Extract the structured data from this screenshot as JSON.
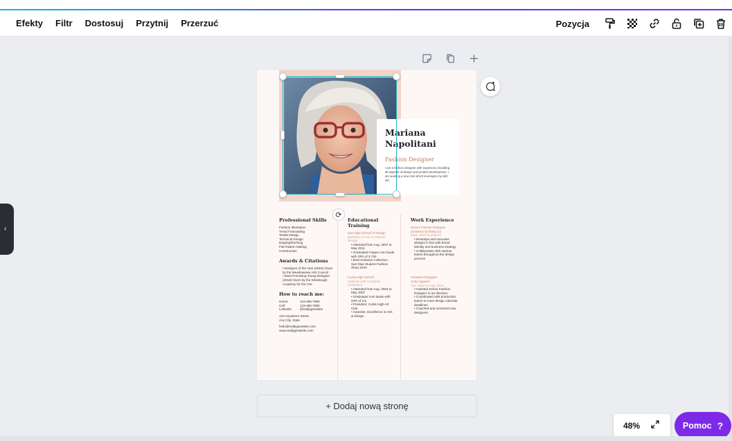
{
  "toolbar": {
    "items": [
      "Efekty",
      "Filtr",
      "Dostosuj",
      "Przytnij",
      "Przerzuć"
    ],
    "position_label": "Pozycja",
    "icons": [
      "paint-roller-icon",
      "transparency-icon",
      "link-icon",
      "lock-icon",
      "duplicate-icon",
      "trash-icon"
    ]
  },
  "resume": {
    "name_line1": "Mariana",
    "name_line2": "Napolitani",
    "role": "Fashion Designer",
    "bio": "I am a fashion designer with experience handling all aspects of design and product development. I am seeking a new role which leverages my skill set.",
    "skills_title": "Professional Skills",
    "skills": [
      "Fashion Illustration",
      "Trend Forecasting",
      "Textile Design",
      "Technical Design",
      "Draping/Ruching",
      "Flat Pattern Making",
      "Construction"
    ],
    "awards_title": "Awards & Citations",
    "awards": [
      "Designer of the Year (2019) Given by the Meadowview Arts Council",
      "Most Promising Young Designer (2018) Given by the Wiraslough Academy for the Arts"
    ],
    "contact_title": "How to reach me:",
    "contact": [
      {
        "label": "Home:",
        "value": "123-456-7890"
      },
      {
        "label": "Cell:",
        "value": "123-456-7890"
      },
      {
        "label": "LinkedIn:",
        "value": "@reallygreatsite"
      }
    ],
    "address_line1": "123 Anywhere Street,",
    "address_line2": "Any City, State",
    "email": "hello@reallygreatsite.com",
    "website": "www.reallygreatsite.com",
    "education_title": "Educational Training",
    "edu1_school": "San Dias School of Design",
    "edu1_degree": "Bachelor of Arts in Fashion Design",
    "edu1_items": [
      "Attended from Aug. 2007 to May 2011",
      "Graduated magna cum laude with GPA of 3.750",
      "Best Knitwear Collection, San Dias Student Fashion Show 2010"
    ],
    "edu2_school": "Curtis High School",
    "edu2_degree": "Diploma with Academic Distinction",
    "edu2_items": [
      "Attended from Aug. 2003 to May 2007",
      "Graduated cum laude with GPA of 3.5",
      "President, Curtis High Art Club",
      "Awardee, Excellence in Arts & Design"
    ],
    "work_title": "Work Experience",
    "job1_title": "Senior Fashion Designer",
    "job1_company": "23 BAKS Clothing Co.",
    "job1_dates": "Sept. 2019 to present",
    "job1_items": [
      "Develops and executes designs in line with brand identity and business strategy",
      "Collaborates with various teams throughout the design process"
    ],
    "job2_title": "Assistant Designer",
    "job2_company": "Arolo Apparel",
    "job2_dates": "Jan. 2016 to Aug. 2019",
    "job2_items": [
      "Assisted Senior Fashion Designer in art direction",
      "Coordinated with production teams to meet design calendar deadlines",
      "Coached and mentored new designers"
    ]
  },
  "add_page_label": "+ Dodaj nową stronę",
  "zoom": "48%",
  "help_label": "Pomoc",
  "help_icon": "?",
  "colors": {
    "accent": "#7d2ae8",
    "selection": "#19b5c1",
    "resume_accent": "#c07a5a"
  }
}
